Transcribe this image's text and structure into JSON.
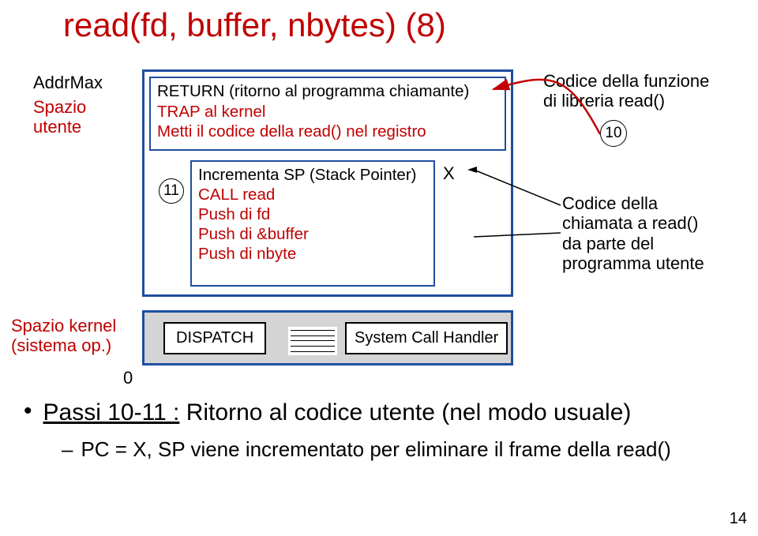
{
  "title": "read(fd, buffer, nbytes) (8)",
  "left": {
    "addrmax": "AddrMax",
    "spazio_utente": "Spazio\nutente",
    "spazio_kernel": "Spazio kernel\n(sistema op.)",
    "zero": "0"
  },
  "user_box": {
    "return_line": "RETURN (ritorno al programma chiamante)",
    "trap_line": "TRAP al kernel",
    "metti_line": "Metti il codice della read() nel registro",
    "step11": "11",
    "inc_sp": "Incrementa SP (Stack Pointer)",
    "call_read": "CALL read",
    "push_fd": "Push di fd",
    "push_buf": "Push di &buffer",
    "push_nbyte": "Push di nbyte",
    "xmark": "X"
  },
  "kernel": {
    "dispatch": "DISPATCH",
    "sch": "System Call Handler"
  },
  "right": {
    "func_lib": "Codice della funzione\ndi libreria read()",
    "step10": "10",
    "call_code": "Codice della\nchiamata a read()\nda parte del\nprogramma utente"
  },
  "bullets": {
    "b1_label": "Passi 10-11 :",
    "b1_rest": " Ritorno al codice utente (nel modo usuale)",
    "b2_dash": "–",
    "b2_text": "PC = X, SP viene incrementato per eliminare il frame della read()"
  },
  "page": "14"
}
